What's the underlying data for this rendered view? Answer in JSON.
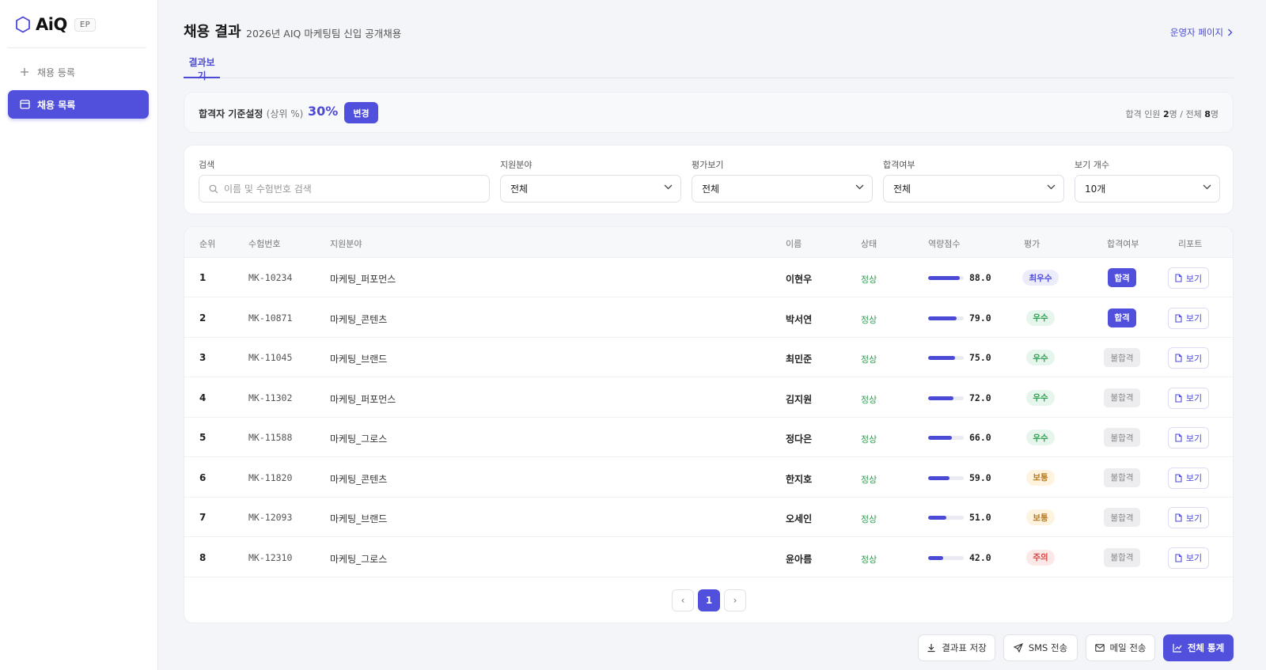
{
  "sidebar": {
    "logo_text": "AiQ",
    "logo_badge": "EP",
    "nav_register": "채용 등록",
    "nav_list": "채용 목록"
  },
  "header": {
    "title": "채용 결과",
    "subtitle": "2026년 AIQ 마케팅팀 신입 공개채용",
    "admin_link": "운영자 페이지",
    "tab": "결과보기"
  },
  "criteria": {
    "label": "합격자 기준설정",
    "label_paren": "(상위 %)",
    "value": "30%",
    "change_button": "변경",
    "summary_prefix": "합격 인원",
    "pass_count": "2",
    "summary_mid": "명 / 전체",
    "total_count": "8",
    "summary_suffix": "명"
  },
  "filters": {
    "search_label": "검색",
    "search_placeholder": "이름 및 수험번호 검색",
    "field_label": "지원분야",
    "field_value": "전체",
    "eval_label": "평가보기",
    "eval_value": "전체",
    "pass_label": "합격여부",
    "pass_value": "전체",
    "count_label": "보기 개수",
    "count_value": "10개"
  },
  "table": {
    "headers": {
      "rank": "순위",
      "id": "수험번호",
      "field": "지원분야",
      "name": "이름",
      "status": "상태",
      "score": "역량점수",
      "grade": "평가",
      "pass": "합격여부",
      "report": "리포트"
    },
    "rows": [
      {
        "rank": "1",
        "id": "MK-10234",
        "field": "마케팅_퍼포먼스",
        "name": "이현우",
        "status": "정상",
        "score": 88.0,
        "score_text": "88.0",
        "grade": "최우수",
        "pass": "합격",
        "report": "보기"
      },
      {
        "rank": "2",
        "id": "MK-10871",
        "field": "마케팅_콘텐츠",
        "name": "박서연",
        "status": "정상",
        "score": 79.0,
        "score_text": "79.0",
        "grade": "우수",
        "pass": "합격",
        "report": "보기"
      },
      {
        "rank": "3",
        "id": "MK-11045",
        "field": "마케팅_브랜드",
        "name": "최민준",
        "status": "정상",
        "score": 75.0,
        "score_text": "75.0",
        "grade": "우수",
        "pass": "불합격",
        "report": "보기"
      },
      {
        "rank": "4",
        "id": "MK-11302",
        "field": "마케팅_퍼포먼스",
        "name": "김지원",
        "status": "정상",
        "score": 72.0,
        "score_text": "72.0",
        "grade": "우수",
        "pass": "불합격",
        "report": "보기"
      },
      {
        "rank": "5",
        "id": "MK-11588",
        "field": "마케팅_그로스",
        "name": "정다은",
        "status": "정상",
        "score": 66.0,
        "score_text": "66.0",
        "grade": "우수",
        "pass": "불합격",
        "report": "보기"
      },
      {
        "rank": "6",
        "id": "MK-11820",
        "field": "마케팅_콘텐츠",
        "name": "한지호",
        "status": "정상",
        "score": 59.0,
        "score_text": "59.0",
        "grade": "보통",
        "pass": "불합격",
        "report": "보기"
      },
      {
        "rank": "7",
        "id": "MK-12093",
        "field": "마케팅_브랜드",
        "name": "오세인",
        "status": "정상",
        "score": 51.0,
        "score_text": "51.0",
        "grade": "보통",
        "pass": "불합격",
        "report": "보기"
      },
      {
        "rank": "8",
        "id": "MK-12310",
        "field": "마케팅_그로스",
        "name": "윤아름",
        "status": "정상",
        "score": 42.0,
        "score_text": "42.0",
        "grade": "주의",
        "pass": "불합격",
        "report": "보기"
      }
    ]
  },
  "pagination": {
    "prev": "‹",
    "current": "1",
    "next": "›"
  },
  "actions": {
    "save": "결과표 저장",
    "sms": "SMS 전송",
    "mail": "메일 전송",
    "stats": "전체 통계"
  },
  "colors": {
    "accent": "#5150dd",
    "status_ok": "#2f9e50",
    "grade_top_bg": "#ececfb",
    "grade_top_fg": "#4b4ad6",
    "grade_good_bg": "#e7f6ec",
    "grade_good_fg": "#2f9e50",
    "grade_mid_bg": "#fdf3df",
    "grade_mid_fg": "#b7791f",
    "grade_warn_bg": "#fde8e8",
    "grade_warn_fg": "#d64545"
  }
}
